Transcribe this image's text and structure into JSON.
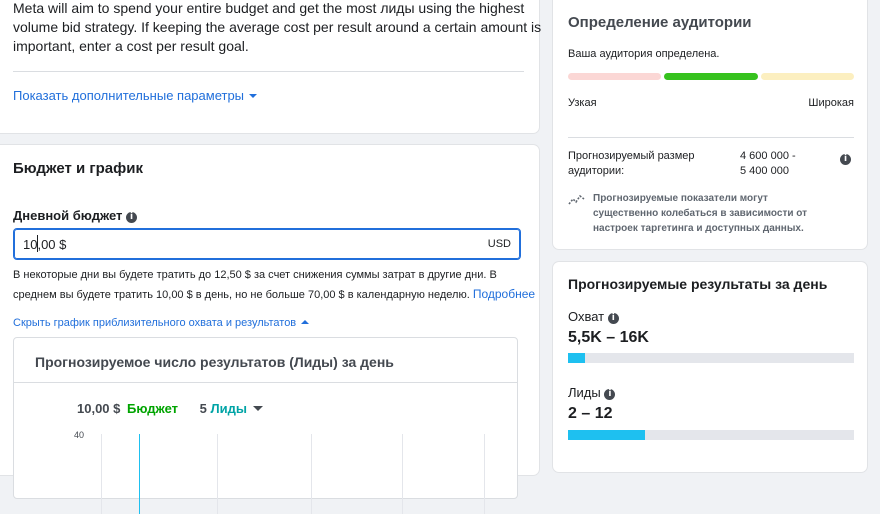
{
  "top_card": {
    "description_lines": [
      "Meta will aim to spend your entire budget and get the most лиды using the highest",
      "volume bid strategy. If keeping the average cost per result around a certain amount is",
      "important, enter a cost per result goal."
    ],
    "more_options_link": "Показать дополнительные параметры"
  },
  "budget_card": {
    "title": "Бюджет и график",
    "daily_budget_label": "Дневной бюджет",
    "input_value": "10,00 $",
    "currency": "USD",
    "note_line1": "В некоторые дни вы будете тратить до 12,50 $ за счет снижения суммы затрат в другие дни. В",
    "note_line2": "среднем вы будете тратить 10,00 $ в день, но не больше 70,00 $ в календарную неделю.",
    "learn_more": "Подробнее",
    "hide_chart_link": "Скрыть график приблизительного охвата и результатов"
  },
  "estimate_chart": {
    "title": "Прогнозируемое число результатов (Лиды) за день",
    "budget_value": "10,00 $",
    "budget_label": "Бюджет",
    "results_value": "5",
    "results_label": "Лиды",
    "y_tick": "40"
  },
  "audience_card": {
    "title": "Определение аудитории",
    "status": "Ваша аудитория определена.",
    "narrow_label": "Узкая",
    "wide_label": "Широкая",
    "size_label_line1": "Прогнозируемый размер",
    "size_label_line2": "аудитории:",
    "size_value_line1": "4 600 000 -",
    "size_value_line2": "5 400 000",
    "note_line1": "Прогнозируемые показатели могут",
    "note_line2": "существенно колебаться в зависимости от",
    "note_line3": "настроек таргетинга и доступных данных.",
    "colors": {
      "narrow": "#fbd7d5",
      "defined": "#36c21e",
      "wide": "#fcefc0"
    }
  },
  "daily_results_card": {
    "title": "Прогнозируемые результаты за день",
    "reach_label": "Охват",
    "reach_value": "5,5K – 16K",
    "reach_fill_fraction": 0.06,
    "leads_label": "Лиды",
    "leads_value": "2 – 12",
    "leads_fill_fraction": 0.27,
    "bar_color": "#1ec0f0"
  }
}
